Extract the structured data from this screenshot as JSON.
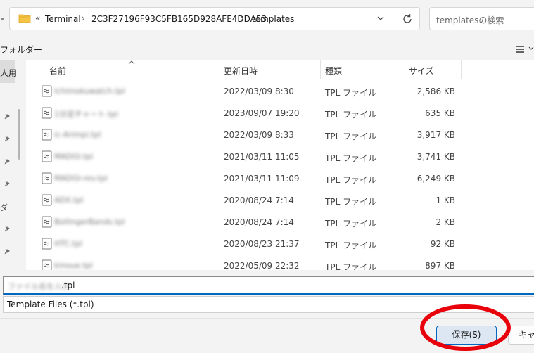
{
  "address_bar": {
    "overflow_glyph": "«",
    "breadcrumbs": [
      "Terminal",
      "2C3F27196F93C5FB165D928AFE4DDA53",
      "templates"
    ],
    "separator": "›"
  },
  "search": {
    "placeholder": "templatesの検索"
  },
  "toolbar": {
    "new_folder_fragment": "フォルダー"
  },
  "nav": {
    "selected_fragment": "人用",
    "edge_fragment": "ダ"
  },
  "columns": {
    "name": "名前",
    "modified": "更新日時",
    "type": "種類",
    "size": "サイズ"
  },
  "files": [
    {
      "name": "Ichimokuwatch.tpl",
      "modified": "2022/03/09 8:30",
      "type": "TPL ファイル",
      "size": "2,586 KB"
    },
    {
      "name": "1分足チャート.tpl",
      "modified": "2023/09/07 19:20",
      "type": "TPL ファイル",
      "size": "635 KB"
    },
    {
      "name": "ic-Arimpi.tpl",
      "modified": "2022/03/09 8:33",
      "type": "TPL ファイル",
      "size": "3,917 KB"
    },
    {
      "name": "MADGI.tpl",
      "modified": "2021/03/11 11:05",
      "type": "TPL ファイル",
      "size": "3,741 KB"
    },
    {
      "name": "MADGI-rev.tpl",
      "modified": "2021/03/11 11:09",
      "type": "TPL ファイル",
      "size": "6,249 KB"
    },
    {
      "name": "ADX.tpl",
      "modified": "2020/08/24 7:14",
      "type": "TPL ファイル",
      "size": "1 KB"
    },
    {
      "name": "BollingerBands.tpl",
      "modified": "2020/08/24 7:14",
      "type": "TPL ファイル",
      "size": "2 KB"
    },
    {
      "name": "HTC.tpl",
      "modified": "2020/08/23 21:37",
      "type": "TPL ファイル",
      "size": "92 KB"
    },
    {
      "name": "kinoue.tpl",
      "modified": "2022/05/09 22:32",
      "type": "TPL ファイル",
      "size": "897 KB"
    }
  ],
  "filename_field": {
    "blurred_part": "ファイル名を入力",
    "extension": ".tpl"
  },
  "file_type": {
    "selected": "Template Files (*.tpl)"
  },
  "buttons": {
    "save": "保存(S)",
    "cancel": "キャンセル"
  },
  "colors": {
    "accent": "#0067c0",
    "highlight": "#e8000b",
    "folder": "#f6c444"
  }
}
